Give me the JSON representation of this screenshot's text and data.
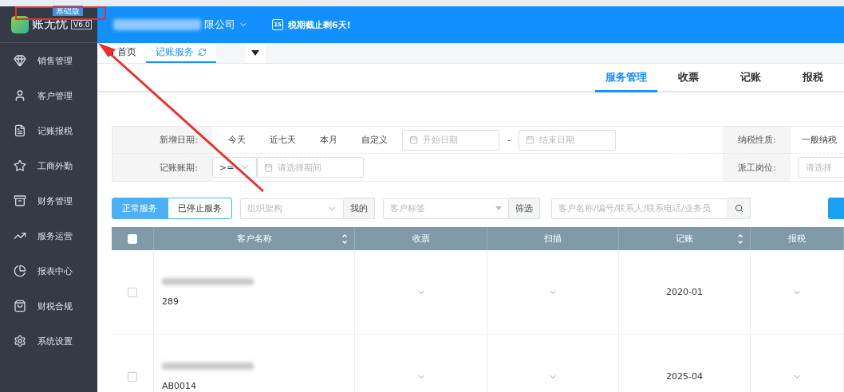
{
  "brand": {
    "name": "账无忧",
    "version": "V6.0",
    "edition": "基础版"
  },
  "header": {
    "company_suffix": "限公司",
    "deadline_day": "15",
    "deadline_text": "税期截止剩6天!"
  },
  "sidebar": {
    "items": [
      {
        "label": "销售管理"
      },
      {
        "label": "客户管理"
      },
      {
        "label": "记账报税"
      },
      {
        "label": "工商外勤"
      },
      {
        "label": "财务管理"
      },
      {
        "label": "服务运营"
      },
      {
        "label": "报表中心"
      },
      {
        "label": "财税合规"
      },
      {
        "label": "系统设置"
      }
    ]
  },
  "tabs": [
    {
      "label": "首页",
      "selected": false,
      "kind": "home"
    },
    {
      "label": "记账服务",
      "selected": true,
      "kind": "refresh"
    }
  ],
  "subtabs": [
    {
      "label": "服务管理",
      "selected": true
    },
    {
      "label": "收票",
      "selected": false
    },
    {
      "label": "记账",
      "selected": false
    },
    {
      "label": "报税",
      "selected": false
    }
  ],
  "filters": {
    "date_label": "新增日期:",
    "date_options": [
      "今天",
      "近七天",
      "本月",
      "自定义"
    ],
    "start_placeholder": "开始日期",
    "range_sep": "-",
    "end_placeholder": "结束日期",
    "period_label": "记账账期:",
    "period_op": ">=",
    "period_placeholder": "请选择期间",
    "tax_label": "纳税性质:",
    "tax_value": "一般纳税",
    "post_label": "派工岗位:",
    "post_placeholder": "请选择"
  },
  "toolbar": {
    "status": [
      {
        "label": "正常服务",
        "selected": true
      },
      {
        "label": "已停止服务",
        "selected": false
      }
    ],
    "org_placeholder": "组织架构",
    "mine": "我的",
    "tag_placeholder": "客户标签",
    "filter": "筛选",
    "search_placeholder": "客户名称/编号/联系人/联系电话/业务员"
  },
  "table": {
    "select_all_checked": false,
    "columns": [
      {
        "label": "客户名称",
        "sortable": true
      },
      {
        "label": "收票",
        "sortable": false
      },
      {
        "label": "扫描",
        "sortable": false
      },
      {
        "label": "记账",
        "sortable": true
      },
      {
        "label": "报税",
        "sortable": false
      }
    ],
    "rows": [
      {
        "checked": false,
        "code": "289",
        "period": "2020-01"
      },
      {
        "checked": false,
        "code": "AB0014",
        "period": "2025-04"
      }
    ]
  }
}
